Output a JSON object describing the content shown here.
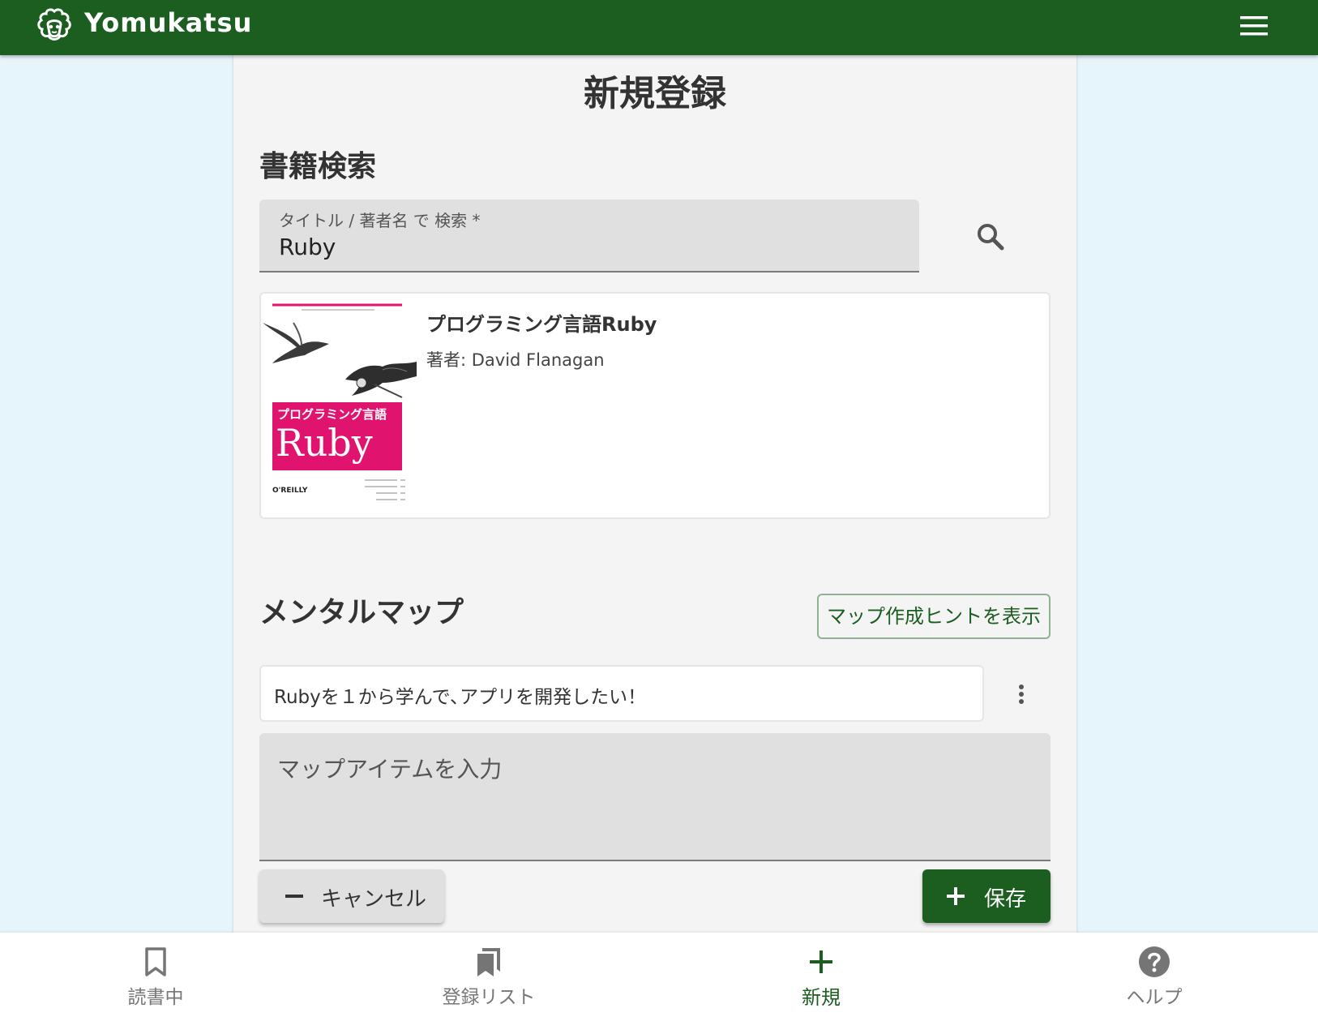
{
  "app": {
    "brand": "Yomukatsu",
    "primary_color": "#1b5e20",
    "background_color": "#e6f4fb"
  },
  "page": {
    "title": "新規登録"
  },
  "search": {
    "section_title": "書籍検索",
    "label": "タイトル / 著者名 で 検索 *",
    "value": "Ruby"
  },
  "book_result": {
    "title": "プログラミング言語Ruby",
    "author": "著者: David Flanagan",
    "cover": {
      "title_jp": "プログラミング言語",
      "title_en": "Ruby",
      "publisher": "O'REILLY",
      "accent_color": "#e0136f"
    }
  },
  "mental_map": {
    "section_title": "メンタルマップ",
    "hint_button": "マップ作成ヒントを表示",
    "center_text": "Rubyを１から学んで､アプリを開発したい！",
    "item_placeholder": "マップアイテムを入力"
  },
  "actions": {
    "cancel_label": "キャンセル",
    "save_label": "保存"
  },
  "bottom_nav": {
    "items": [
      {
        "label": "読書中",
        "icon": "bookmark-outline-icon",
        "active": false
      },
      {
        "label": "登録リスト",
        "icon": "bookmarks-icon",
        "active": false
      },
      {
        "label": "新規",
        "icon": "plus-icon",
        "active": true
      },
      {
        "label": "ヘルプ",
        "icon": "help-circle-icon",
        "active": false
      }
    ]
  }
}
